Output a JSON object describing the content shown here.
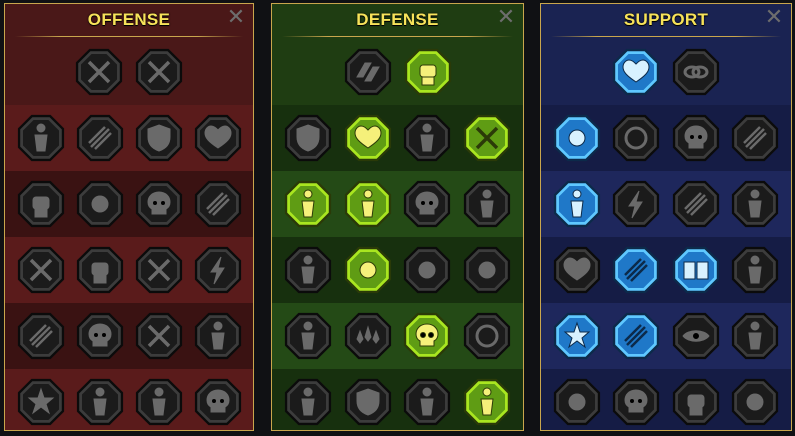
{
  "panels": [
    {
      "key": "offense",
      "title": "OFFENSE",
      "close_symbol": "✕",
      "top_row": [
        {
          "icon": "crossed-swords-icon",
          "active": false
        },
        {
          "icon": "slash-blades-icon",
          "active": false
        }
      ],
      "rows": [
        [
          {
            "icon": "horned-helm-icon",
            "active": false
          },
          {
            "icon": "claw-slash-icon",
            "active": false
          },
          {
            "icon": "shield-arrow-icon",
            "active": false
          },
          {
            "icon": "cracked-heart-icon",
            "active": false
          }
        ],
        [
          {
            "icon": "fist-strike-icon",
            "active": false
          },
          {
            "icon": "fanged-maw-icon",
            "active": false
          },
          {
            "icon": "skull-icon",
            "active": false
          },
          {
            "icon": "reaper-icon",
            "active": false
          }
        ],
        [
          {
            "icon": "blade-ring-icon",
            "active": false
          },
          {
            "icon": "gauntlet-icon",
            "active": false
          },
          {
            "icon": "axe-strike-icon",
            "active": false
          },
          {
            "icon": "chain-lightning-icon",
            "active": false
          }
        ],
        [
          {
            "icon": "explosion-icon",
            "active": false
          },
          {
            "icon": "skull-cloud-icon",
            "active": false
          },
          {
            "icon": "spear-shield-icon",
            "active": false
          },
          {
            "icon": "berserker-icon",
            "active": false
          }
        ],
        [
          {
            "icon": "starfall-icon",
            "active": false
          },
          {
            "icon": "knight-helm-icon",
            "active": false
          },
          {
            "icon": "demon-icon",
            "active": false
          },
          {
            "icon": "skull-crown-icon",
            "active": false
          }
        ]
      ]
    },
    {
      "key": "defense",
      "title": "DEFENSE",
      "close_symbol": "✕",
      "top_row": [
        {
          "icon": "brick-wall-icon",
          "active": false
        },
        {
          "icon": "raised-fist-icon",
          "active": true
        }
      ],
      "rows": [
        [
          {
            "icon": "chevron-armor-icon",
            "active": false
          },
          {
            "icon": "heart-shield-icon",
            "active": true
          },
          {
            "icon": "armored-torso-icon",
            "active": false
          },
          {
            "icon": "dual-blades-icon",
            "active": true
          }
        ],
        [
          {
            "icon": "heal-figure-icon",
            "active": true
          },
          {
            "icon": "guard-knight-icon",
            "active": true
          },
          {
            "icon": "skull-heart-icon",
            "active": false
          },
          {
            "icon": "halo-figure-icon",
            "active": false
          }
        ],
        [
          {
            "icon": "crowd-icon",
            "active": false
          },
          {
            "icon": "hourglass-icon",
            "active": true
          },
          {
            "icon": "open-hand-icon",
            "active": false
          },
          {
            "icon": "bull-icon",
            "active": false
          }
        ],
        [
          {
            "icon": "speed-runner-icon",
            "active": false
          },
          {
            "icon": "triple-drops-icon",
            "active": false
          },
          {
            "icon": "radiant-skull-icon",
            "active": true
          },
          {
            "icon": "no-entry-icon",
            "active": false
          }
        ],
        [
          {
            "icon": "flame-warrior-icon",
            "active": false
          },
          {
            "icon": "crest-shield-icon",
            "active": false
          },
          {
            "icon": "ogre-icon",
            "active": false
          },
          {
            "icon": "flexing-giant-icon",
            "active": true
          }
        ]
      ]
    },
    {
      "key": "support",
      "title": "SUPPORT",
      "close_symbol": "✕",
      "top_row": [
        {
          "icon": "heart-sparkle-icon",
          "active": true
        },
        {
          "icon": "chain-link-icon",
          "active": false
        }
      ],
      "rows": [
        [
          {
            "icon": "praying-hands-icon",
            "active": true
          },
          {
            "icon": "aura-ring-icon",
            "active": false
          },
          {
            "icon": "flaming-skull-icon",
            "active": false
          },
          {
            "icon": "speed-arrow-icon",
            "active": false
          }
        ],
        [
          {
            "icon": "sparkle-figure-icon",
            "active": true
          },
          {
            "icon": "lightning-bolt-icon",
            "active": false
          },
          {
            "icon": "crack-icon",
            "active": false
          },
          {
            "icon": "shadow-figures-icon",
            "active": false
          }
        ],
        [
          {
            "icon": "chained-heart-icon",
            "active": false
          },
          {
            "icon": "comet-icon",
            "active": true
          },
          {
            "icon": "open-book-icon",
            "active": true
          },
          {
            "icon": "demon-face-icon",
            "active": false
          }
        ],
        [
          {
            "icon": "compass-star-icon",
            "active": true
          },
          {
            "icon": "winged-boot-icon",
            "active": true
          },
          {
            "icon": "eye-icon",
            "active": false
          },
          {
            "icon": "martial-artist-icon",
            "active": false
          }
        ],
        [
          {
            "icon": "potion-icon",
            "active": false
          },
          {
            "icon": "skull-horns-icon",
            "active": false
          },
          {
            "icon": "fist-smash-icon",
            "active": false
          },
          {
            "icon": "eagle-icon",
            "active": false
          }
        ]
      ]
    }
  ],
  "colors": {
    "title": "#f7e35a",
    "border": "#c9a64d",
    "offense_bg": "#4a1818",
    "defense_bg": "#1f3d12",
    "support_bg": "#1a2352",
    "active_green": "#a9e620",
    "active_blue": "#5fc8ff"
  }
}
